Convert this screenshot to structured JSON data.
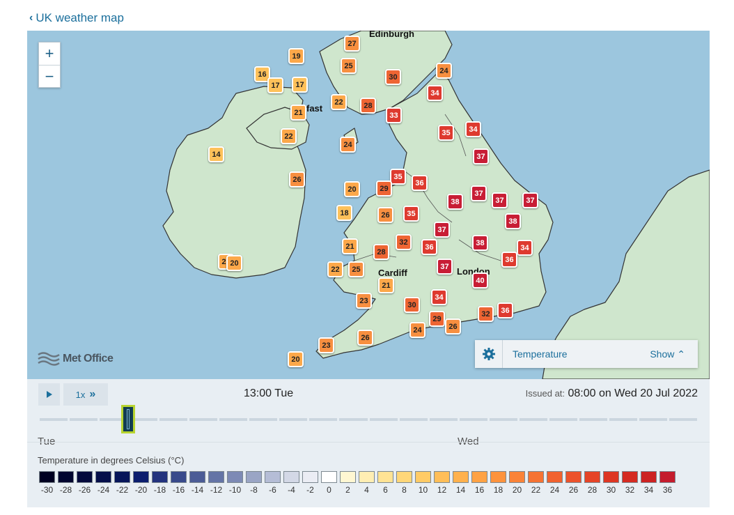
{
  "back_link": {
    "label": "UK weather map"
  },
  "map": {
    "zoom_in": "+",
    "zoom_out": "−",
    "cities": [
      "Edinburgh",
      "fast",
      "Cardiff",
      "London"
    ],
    "logo_text": "Met Office",
    "layer_panel": {
      "layer": "Temperature",
      "toggle": "Show"
    },
    "temperatures": [
      27,
      19,
      25,
      16,
      17,
      17,
      30,
      24,
      34,
      22,
      28,
      21,
      33,
      22,
      35,
      34,
      24,
      14,
      37,
      26,
      35,
      36,
      20,
      29,
      37,
      37,
      38,
      37,
      18,
      26,
      35,
      38,
      37,
      32,
      21,
      28,
      36,
      38,
      34,
      22,
      25,
      20,
      20,
      36,
      37,
      21,
      40,
      23,
      30,
      34,
      32,
      36,
      29,
      26,
      24,
      26,
      23,
      20
    ]
  },
  "controls": {
    "speed": "1x",
    "current_time": "13:00 Tue",
    "issued_label": "Issued at:",
    "issued_value": "08:00 on Wed 20 Jul 2022",
    "days": [
      "Tue",
      "Wed"
    ]
  },
  "legend": {
    "title": "Temperature in degrees Celsius (°C)",
    "labels": [
      "-30",
      "-28",
      "-26",
      "-24",
      "-22",
      "-20",
      "-18",
      "-16",
      "-14",
      "-12",
      "-10",
      "-8",
      "-6",
      "-4",
      "-2",
      "0",
      "2",
      "4",
      "6",
      "8",
      "10",
      "12",
      "14",
      "16",
      "18",
      "20",
      "22",
      "24",
      "26",
      "28",
      "30",
      "32",
      "34",
      "36"
    ],
    "colors": [
      "#000021",
      "#00052f",
      "#03093c",
      "#050f4b",
      "#07165a",
      "#0b1d6e",
      "#23337e",
      "#384a8b",
      "#4b5c96",
      "#6474a6",
      "#7d8ab5",
      "#9aa5c5",
      "#b5bdd6",
      "#d3d8e6",
      "#ebedf4",
      "#ffffff",
      "#fff7d2",
      "#ffeeb3",
      "#ffe394",
      "#ffd779",
      "#ffcb66",
      "#ffbe58",
      "#ffb14d",
      "#ffa244",
      "#fd933d",
      "#fa8338",
      "#f67333",
      "#f1622f",
      "#ec522b",
      "#e54427",
      "#dd3623",
      "#d52b22",
      "#cc2222",
      "#c41c2d"
    ]
  }
}
